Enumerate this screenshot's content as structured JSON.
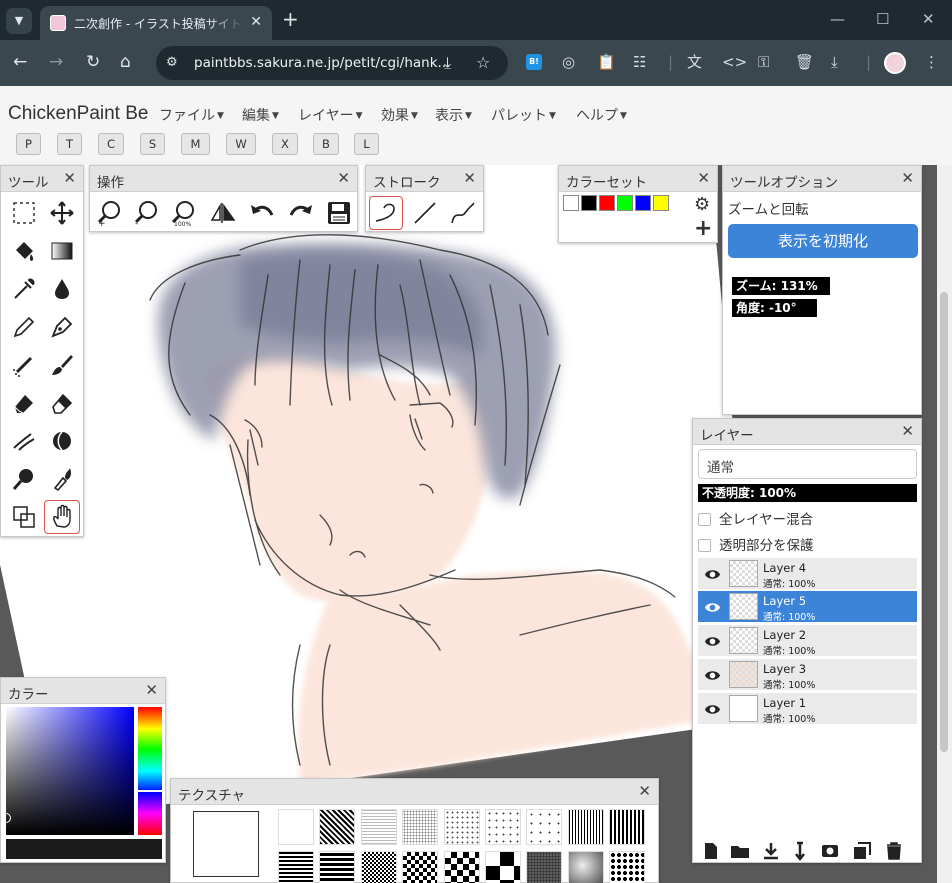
{
  "browser": {
    "tab_title": "二次創作 - イラスト投稿サイト Petit",
    "url": "paintbbs.sakura.ne.jp/petit/cgi/hank...",
    "ext_b_label": "B!"
  },
  "app": {
    "brand": "ChickenPaint Be",
    "menus": [
      "ファイル",
      "編集",
      "レイヤー",
      "効果",
      "表示",
      "パレット",
      "ヘルプ"
    ],
    "toolbar_buttons": [
      "P",
      "T",
      "C",
      "S",
      "M",
      "W",
      "X",
      "B",
      "L"
    ]
  },
  "panels": {
    "tools_title": "ツール",
    "ops_title": "操作",
    "stroke_title": "ストローク",
    "colorset_title": "カラーセット",
    "colorset": [
      "#ffffff",
      "#000000",
      "#ff0000",
      "#00ff00",
      "#0000ff",
      "#ffff00"
    ],
    "tool_options_title": "ツールオプション",
    "tool_options_subtitle": "ズームと回転",
    "reset_view_label": "表示を初期化",
    "zoom_label": "ズーム: 131%",
    "angle_label": "角度: -10°",
    "zoom_percent": 131,
    "angle_degrees": -10,
    "layers_title": "レイヤー",
    "blend_mode": "通常",
    "opacity_label": "不透明度: 100%",
    "opacity_percent": 100,
    "sample_all_label": "全レイヤー混合",
    "lock_alpha_label": "透明部分を保護",
    "layers": [
      {
        "name": "Layer 4",
        "mode": "通常: 100%",
        "active": false
      },
      {
        "name": "Layer 5",
        "mode": "通常: 100%",
        "active": true
      },
      {
        "name": "Layer 2",
        "mode": "通常: 100%",
        "active": false
      },
      {
        "name": "Layer 3",
        "mode": "通常: 100%",
        "active": false
      },
      {
        "name": "Layer 1",
        "mode": "通常: 100%",
        "active": false
      }
    ],
    "color_title": "カラー",
    "texture_title": "テクスチャ"
  }
}
